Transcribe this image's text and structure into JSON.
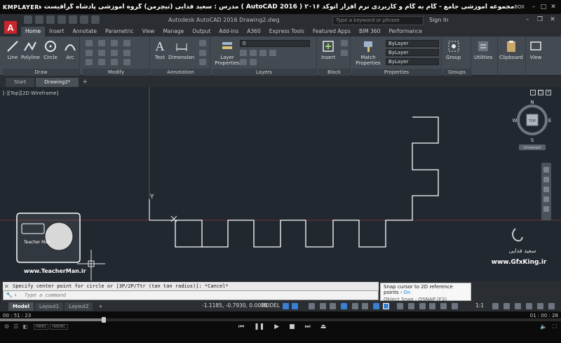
{
  "kmplayer": {
    "logo": "KMPLAYER",
    "title": "مجموعه آموزشی جامع - گام به گام و کاربردی نرم افزار  اتوکد ۲۰۱۶ ( AutoCAD  2016 )  مدرس : سعید فدایی (تیچرمن) گروه آموزشی پادشاه گرافیست ها",
    "box_label": "BOX",
    "time_current": "00 : 51 : 23",
    "time_total": "01 : 00 : 28",
    "progress": 0.185,
    "badges": [
      "HWEC",
      "HWDEC"
    ]
  },
  "autocad": {
    "app_title": "Autodesk AutoCAD 2016    Drawing2.dwg",
    "search_placeholder": "Type a keyword or phrase",
    "sign_in": "Sign In",
    "ribbon_tabs": [
      "Home",
      "Insert",
      "Annotate",
      "Parametric",
      "View",
      "Manage",
      "Output",
      "Add-ins",
      "A360",
      "Express Tools",
      "Featured Apps",
      "BIM 360",
      "Performance"
    ],
    "active_tab": "Home",
    "panels": {
      "draw": {
        "title": "Draw",
        "buttons": [
          "Line",
          "Polyline",
          "Circle",
          "Arc"
        ]
      },
      "modify": {
        "title": "Modify"
      },
      "annotation": {
        "title": "Annotation",
        "buttons": [
          "Text",
          "Dimension"
        ]
      },
      "layers": {
        "title": "Layers",
        "buttons": [
          "Layer Properties"
        ],
        "layer_value": "0"
      },
      "block": {
        "title": "Block",
        "buttons": [
          "Insert"
        ]
      },
      "properties": {
        "title": "Properties",
        "buttons": [
          "Match Properties"
        ],
        "combos": [
          "ByLayer",
          "ByLayer",
          "ByLayer"
        ]
      },
      "groups": {
        "title": "Groups",
        "buttons": [
          "Group"
        ]
      },
      "utilities": {
        "buttons": [
          "Utilities"
        ]
      },
      "clipboard": {
        "buttons": [
          "Clipboard"
        ]
      },
      "view": {
        "buttons": [
          "View"
        ]
      }
    },
    "file_tabs": [
      "Start",
      "Drawing2*"
    ],
    "active_file": "Drawing2*",
    "viewport_label": "[-][Top][2D Wireframe]",
    "viewcube": {
      "top": "TOP",
      "n": "N",
      "s": "S",
      "e": "E",
      "w": "W",
      "ucs": "Unnamed"
    },
    "axis_label": "Y",
    "command_history": "Specify center point for circle or [3P/2P/Ttr (tan tan radius)]: *Cancel*",
    "command_placeholder": "Type a command",
    "layout_tabs": [
      "Model",
      "Layout1",
      "Layout2"
    ],
    "active_layout": "Model",
    "coordinates": "-1.1185, -0.7930, 0.0000",
    "model_label": "MODEL",
    "scale_label": "1:1",
    "tooltip": {
      "title": "Snap cursor to 2D reference points - ",
      "state": "On",
      "subtitle": "Object Snap - OSNAP (F3)"
    }
  },
  "watermark": {
    "teacherman_url": "www.TeacherMan.ir",
    "teacherman_caption": "Teacher Man",
    "author_fa": "سعید فدایی",
    "gfx_url": "www.GfxKing.ir"
  },
  "colors": {
    "canvas": "#212830",
    "geometry": "#ffffff",
    "ribbon": "#434a52",
    "accent": "#1e7fd6"
  }
}
